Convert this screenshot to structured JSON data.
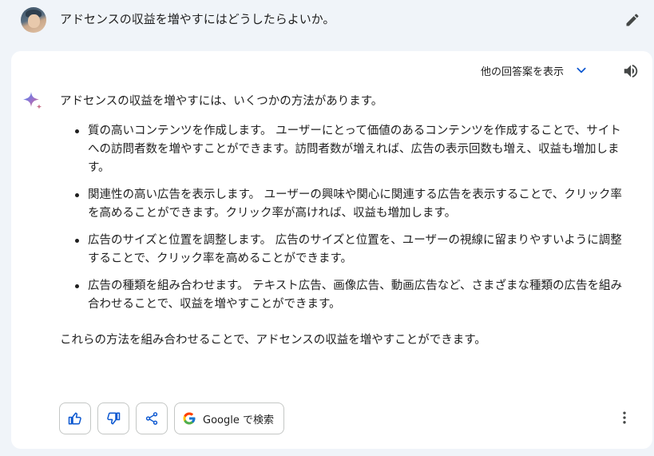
{
  "prompt": {
    "text": "アドセンスの収益を増やすにはどうしたらよいか。",
    "edit_icon": "pencil-icon"
  },
  "response": {
    "drafts_label": "他の回答案を表示",
    "intro": "アドセンスの収益を増やすには、いくつかの方法があります。",
    "points": [
      {
        "text": "質の高いコンテンツを作成します。 ユーザーにとって価値のあるコンテンツを作成することで、サイトへの訪問者数を増やすことができます。訪問者数が増えれば、広告の表示回数も増え、収益も増加します。"
      },
      {
        "text": "関連性の高い広告を表示します。 ユーザーの興味や関心に関連する広告を表示することで、クリック率を高めることができます。クリック率が高ければ、収益も増加します。"
      },
      {
        "text": "広告のサイズと位置を調整します。 広告のサイズと位置を、ユーザーの視線に留まりやすいように調整することで、クリック率を高めることができます。"
      },
      {
        "text": "広告の種類を組み合わせます。 テキスト広告、画像広告、動画広告など、さまざまな種類の広告を組み合わせることで、収益を増やすことができます。"
      }
    ],
    "conclusion": "これらの方法を組み合わせることで、アドセンスの収益を増やすことができます。"
  },
  "actions": {
    "google_search_label": "Google で検索",
    "icons": [
      "thumbs-up-icon",
      "thumbs-down-icon",
      "share-icon",
      "google-g-icon",
      "more-vert-icon"
    ]
  },
  "colors": {
    "background": "#f0f4f9",
    "card": "#ffffff",
    "accent_blue": "#0b57d0",
    "border": "#c4c7c5"
  }
}
